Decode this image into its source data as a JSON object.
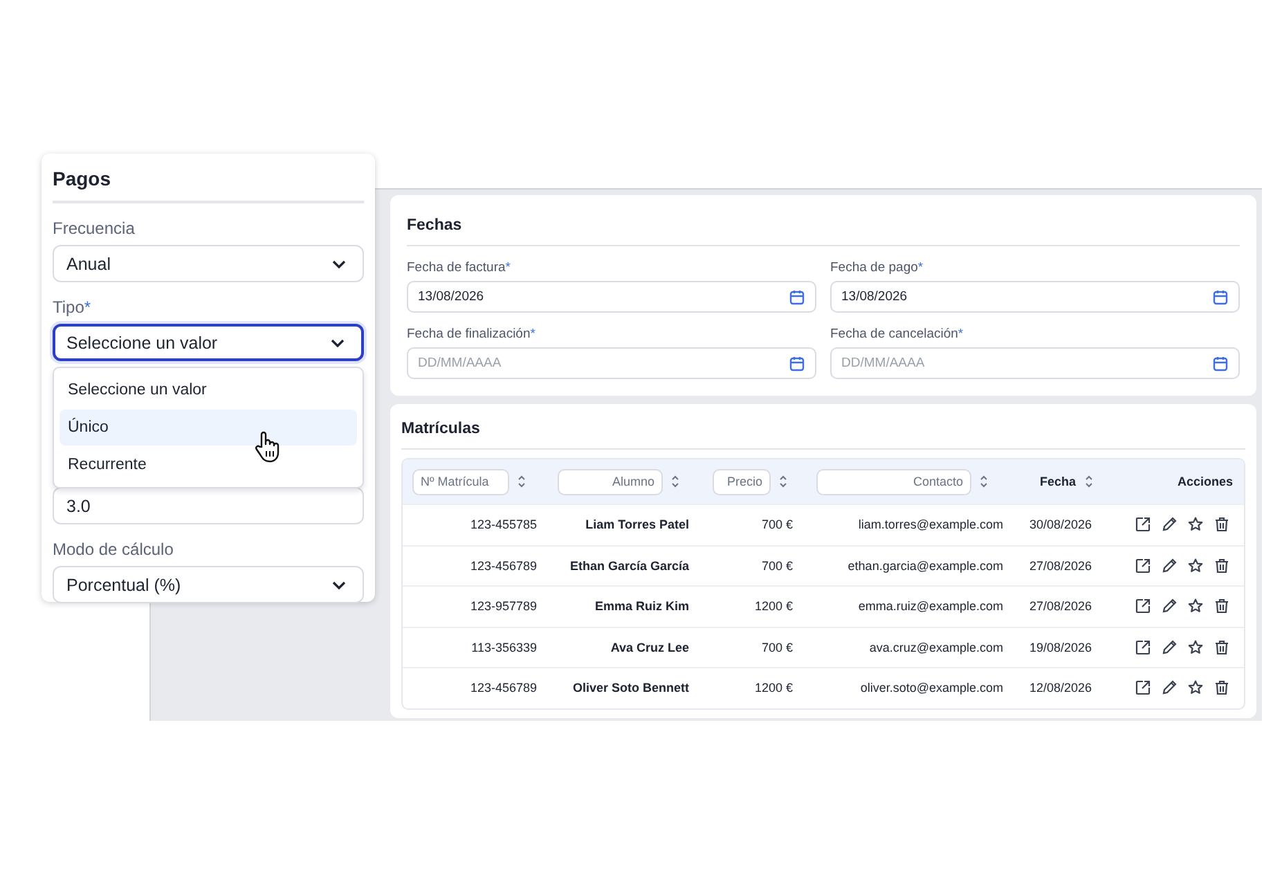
{
  "fechas": {
    "title": "Fechas",
    "fields": [
      {
        "label": "Fecha de factura",
        "required_mark": "*",
        "value": "13/08/2026"
      },
      {
        "label": "Fecha de pago",
        "required_mark": "*",
        "value": "13/08/2026"
      },
      {
        "label": "Fecha de finalización",
        "required_mark": "*",
        "placeholder": "DD/MM/AAAA"
      },
      {
        "label": "Fecha de cancelación",
        "required_mark": "*",
        "placeholder": "DD/MM/AAAA"
      }
    ]
  },
  "matriculas": {
    "title": "Matrículas",
    "columns": [
      {
        "kind": "filter",
        "placeholder": "Nº Matrícula"
      },
      {
        "kind": "filter",
        "placeholder": "Alumno"
      },
      {
        "kind": "filter",
        "placeholder": "Precio"
      },
      {
        "kind": "filter",
        "placeholder": "Contacto"
      },
      {
        "kind": "label",
        "label": "Fecha"
      },
      {
        "kind": "actions",
        "label": "Acciones"
      }
    ],
    "rows": [
      {
        "matricula": "123-455785",
        "alumno": "Liam Torres Patel",
        "precio": "700 €",
        "contacto": "liam.torres@example.com",
        "fecha": "30/08/2026"
      },
      {
        "matricula": "123-456789",
        "alumno": "Ethan García García",
        "precio": "700 €",
        "contacto": "ethan.garcia@example.com",
        "fecha": "27/08/2026"
      },
      {
        "matricula": "123-957789",
        "alumno": "Emma Ruiz Kim",
        "precio": "1200 €",
        "contacto": "emma.ruiz@example.com",
        "fecha": "27/08/2026"
      },
      {
        "matricula": "113-356339",
        "alumno": "Ava Cruz Lee",
        "precio": "700 €",
        "contacto": "ava.cruz@example.com",
        "fecha": "19/08/2026"
      },
      {
        "matricula": "123-456789",
        "alumno": "Oliver Soto Bennett",
        "precio": "1200 €",
        "contacto": "oliver.soto@example.com",
        "fecha": "12/08/2026"
      }
    ]
  },
  "pagos": {
    "title": "Pagos",
    "fields": [
      {
        "kind": "select",
        "label": "Frecuencia",
        "value": "Anual",
        "focused": false
      },
      {
        "kind": "select",
        "label": "Tipo",
        "required_mark": "*",
        "value": "Seleccione un valor",
        "focused": true,
        "expanded": true,
        "options": [
          {
            "label": "Seleccione un valor",
            "hovered": false
          },
          {
            "label": "Único",
            "hovered": true
          },
          {
            "label": "Recurrente",
            "hovered": false
          }
        ]
      },
      {
        "kind": "input",
        "value": "3.0"
      },
      {
        "kind": "select",
        "label": "Modo de cálculo",
        "value": "Porcentual (%)",
        "focused": false
      }
    ]
  }
}
